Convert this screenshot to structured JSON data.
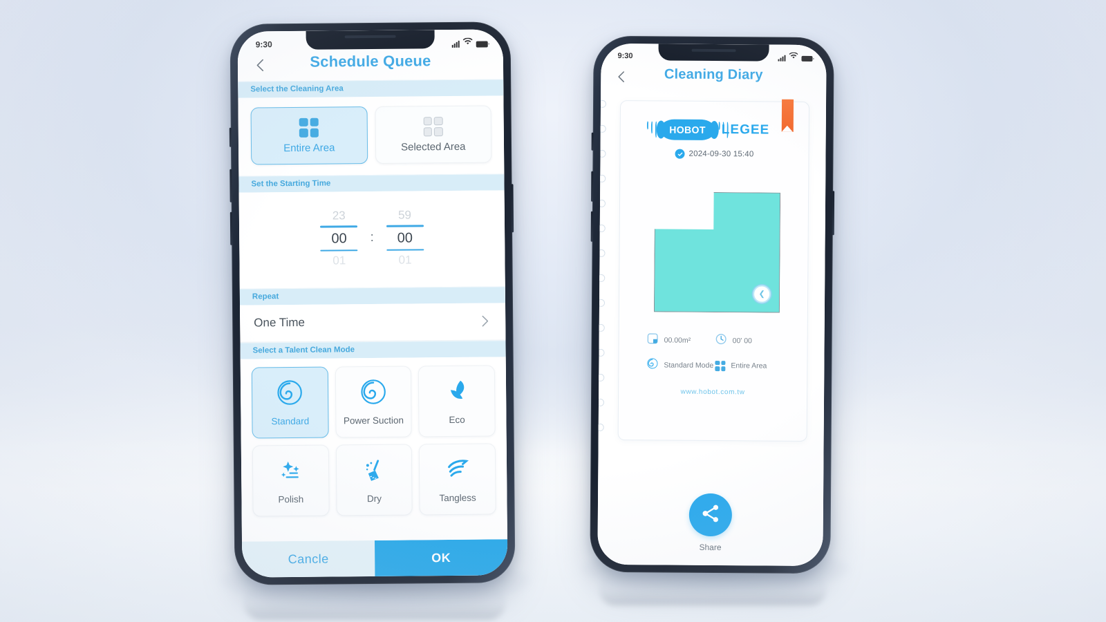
{
  "background": {
    "base_color": "#e6ebf5",
    "accent": "#2aa9ec",
    "map_fill": "#6fe3dd",
    "bookmark": "#f2682c"
  },
  "phone_left": {
    "status_bar": {
      "time": "9:30",
      "signal_icon": "signal-bars-icon",
      "wifi_icon": "wifi-icon",
      "battery_icon": "battery-icon"
    },
    "appbar": {
      "back_icon": "back-chevron-icon",
      "title": "Schedule Queue"
    },
    "section_area": {
      "header": "Select the Cleaning Area",
      "options": [
        {
          "label": "Entire Area",
          "icon": "grid-filled-icon",
          "selected": true
        },
        {
          "label": "Selected Area",
          "icon": "grid-outline-icon",
          "selected": false
        }
      ]
    },
    "section_time": {
      "header": "Set the Starting Time",
      "hour": {
        "above": "23",
        "current": "00",
        "below": "01"
      },
      "separator": ":",
      "minute": {
        "above": "59",
        "current": "00",
        "below": "01"
      }
    },
    "section_repeat": {
      "header": "Repeat",
      "value": "One Time",
      "chevron_icon": "chevron-right-icon"
    },
    "section_mode": {
      "header": "Select a Talent Clean Mode",
      "modes": [
        {
          "label": "Standard",
          "icon": "spiral-icon",
          "selected": true
        },
        {
          "label": "Power Suction",
          "icon": "spiral-icon",
          "selected": false
        },
        {
          "label": "Eco",
          "icon": "leaf-icon",
          "selected": false
        },
        {
          "label": "Polish",
          "icon": "sparkle-icon",
          "selected": false
        },
        {
          "label": "Dry",
          "icon": "broom-icon",
          "selected": false
        },
        {
          "label": "Tangless",
          "icon": "swoosh-icon",
          "selected": false
        }
      ]
    },
    "actions": {
      "cancel": "Cancle",
      "ok": "OK"
    }
  },
  "phone_right": {
    "status_bar": {
      "time": "9:30",
      "signal_icon": "signal-bars-icon",
      "wifi_icon": "wifi-icon",
      "battery_icon": "battery-icon"
    },
    "appbar": {
      "back_icon": "back-chevron-icon",
      "title": "Cleaning Diary"
    },
    "diary": {
      "bookmark_icon": "bookmark-ribbon-icon",
      "brand_mark": "HOBOT",
      "brand_name": "LEGEE",
      "verified_icon": "check-badge-icon",
      "date": "2024-09-30 15:40",
      "map": {
        "robot_icon": "robot-marker-icon"
      },
      "stats": [
        {
          "icon": "area-square-icon",
          "value": "00.00m²"
        },
        {
          "icon": "clock-icon",
          "value": "00' 00"
        },
        {
          "icon": "spiral-icon",
          "value": "Standard Mode"
        },
        {
          "icon": "grid-filled-icon",
          "value": "Entire Area"
        }
      ],
      "website": "www.hobot.com.tw"
    },
    "share": {
      "icon": "share-nodes-icon",
      "label": "Share"
    }
  }
}
